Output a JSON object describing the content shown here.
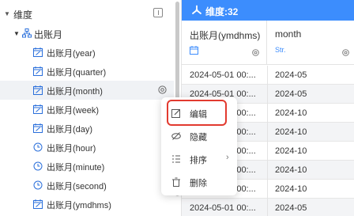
{
  "sidebar": {
    "section_title": "维度",
    "group_label": "出账月",
    "fields": [
      {
        "label": "出账月(year)",
        "icon": "calendar-icon"
      },
      {
        "label": "出账月(quarter)",
        "icon": "calendar-icon"
      },
      {
        "label": "出账月(month)",
        "icon": "calendar-icon",
        "active": true
      },
      {
        "label": "出账月(week)",
        "icon": "calendar-icon"
      },
      {
        "label": "出账月(day)",
        "icon": "calendar-icon"
      },
      {
        "label": "出账月(hour)",
        "icon": "clock-icon"
      },
      {
        "label": "出账月(minute)",
        "icon": "clock-icon"
      },
      {
        "label": "出账月(second)",
        "icon": "clock-icon"
      },
      {
        "label": "出账月(ymdhms)",
        "icon": "calendar-icon"
      }
    ]
  },
  "metric_bar": {
    "label": "维度:32",
    "color": "#3c8dfd"
  },
  "table": {
    "columns": [
      {
        "title": "出账月(ymdhms)",
        "type": "calendar"
      },
      {
        "title": "month",
        "type": "Str."
      }
    ],
    "rows": [
      [
        "2024-05-01 00:...",
        "2024-05"
      ],
      [
        "2024-05-01 00:...",
        "2024-05"
      ],
      [
        "2024-10-01 00:...",
        "2024-10"
      ],
      [
        "2024-10-01 00:...",
        "2024-10"
      ],
      [
        "2024-10-01 00:...",
        "2024-10"
      ],
      [
        "2024-10-01 00:...",
        "2024-10"
      ],
      [
        "2024-10-01 00:...",
        "2024-10"
      ],
      [
        "2024-05-01 00:...",
        "2024-05"
      ]
    ]
  },
  "context_menu": {
    "items": [
      {
        "label": "编辑",
        "icon": "edit-icon"
      },
      {
        "label": "隐藏",
        "icon": "hide-icon"
      },
      {
        "label": "排序",
        "icon": "sort-icon",
        "submenu": true
      },
      {
        "label": "删除",
        "icon": "delete-icon"
      }
    ],
    "highlight_color": "#e23a2f"
  }
}
